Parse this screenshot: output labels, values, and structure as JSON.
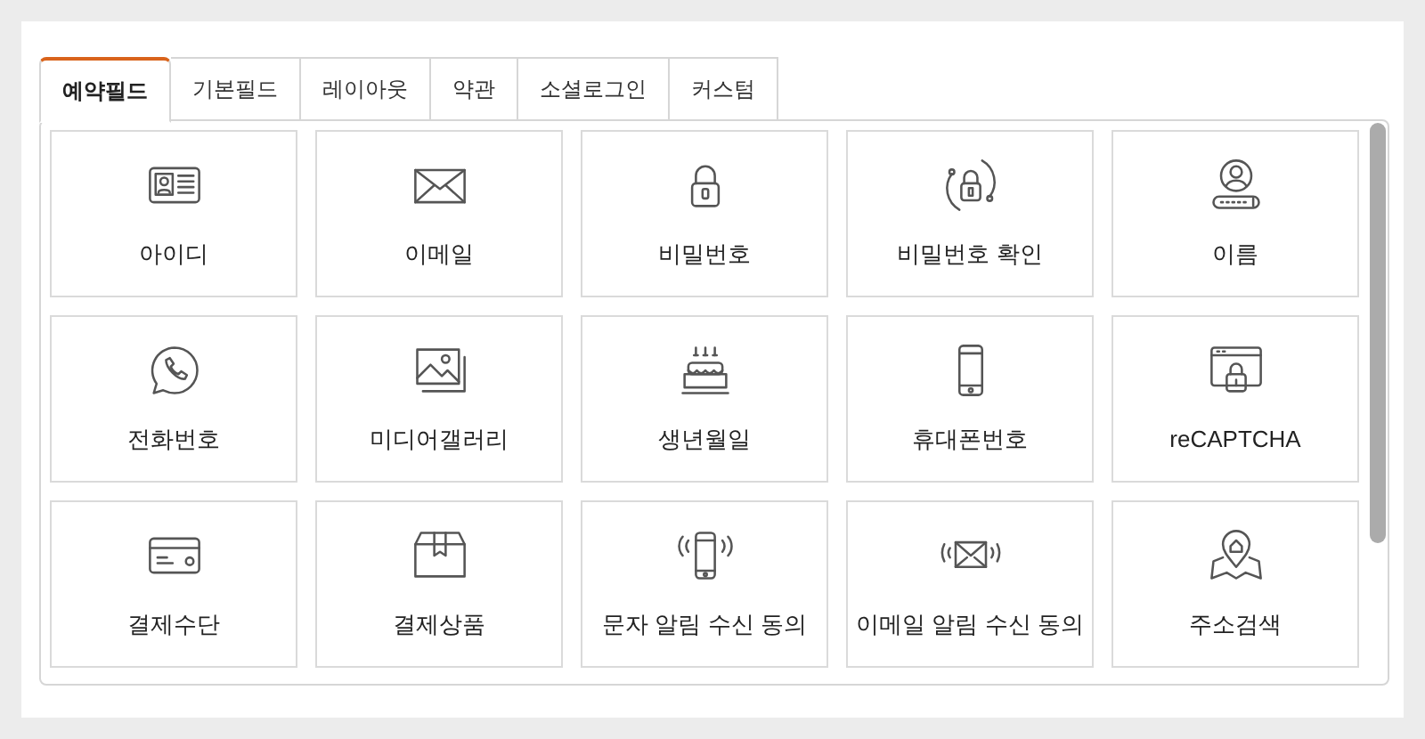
{
  "tabs": [
    {
      "label": "예약필드",
      "selected": true
    },
    {
      "label": "기본필드",
      "selected": false
    },
    {
      "label": "레이아웃",
      "selected": false
    },
    {
      "label": "약관",
      "selected": false
    },
    {
      "label": "소셜로그인",
      "selected": false
    },
    {
      "label": "커스텀",
      "selected": false
    }
  ],
  "fields": [
    {
      "label": "아이디",
      "kind": "idcard"
    },
    {
      "label": "이메일",
      "kind": "envelope"
    },
    {
      "label": "비밀번호",
      "kind": "lock"
    },
    {
      "label": "비밀번호 확인",
      "kind": "lockcycle"
    },
    {
      "label": "이름",
      "kind": "user"
    },
    {
      "label": "전화번호",
      "kind": "phonebubble"
    },
    {
      "label": "미디어갤러리",
      "kind": "images"
    },
    {
      "label": "생년월일",
      "kind": "cake"
    },
    {
      "label": "휴대폰번호",
      "kind": "mobile"
    },
    {
      "label": "reCAPTCHA",
      "kind": "browserlock"
    },
    {
      "label": "결제수단",
      "kind": "card"
    },
    {
      "label": "결제상품",
      "kind": "box"
    },
    {
      "label": "문자 알림 수신 동의",
      "kind": "mobilering"
    },
    {
      "label": "이메일 알림 수신 동의",
      "kind": "envelopering"
    },
    {
      "label": "주소검색",
      "kind": "map"
    }
  ]
}
